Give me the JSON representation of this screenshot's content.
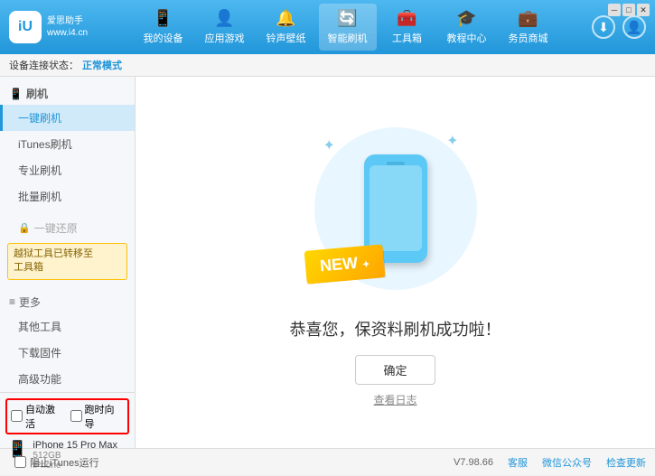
{
  "app": {
    "logo_icon": "iU",
    "logo_line1": "爱思助手",
    "logo_line2": "www.i4.cn"
  },
  "nav": {
    "items": [
      {
        "id": "my-device",
        "icon": "📱",
        "label": "我的设备"
      },
      {
        "id": "apps-games",
        "icon": "👤",
        "label": "应用游戏"
      },
      {
        "id": "ringtones",
        "icon": "🔔",
        "label": "铃声壁纸"
      },
      {
        "id": "smart-flash",
        "icon": "🔄",
        "label": "智能刷机",
        "active": true
      },
      {
        "id": "tools",
        "icon": "🧰",
        "label": "工具箱"
      },
      {
        "id": "tutorials",
        "icon": "🎓",
        "label": "教程中心"
      },
      {
        "id": "services",
        "icon": "💼",
        "label": "务员商城"
      }
    ],
    "download_icon": "⬇",
    "user_icon": "👤"
  },
  "status_bar": {
    "prefix": "设备连接状态：",
    "status": "正常模式"
  },
  "sidebar": {
    "flash_section": "刷机",
    "flash_items": [
      {
        "id": "one-key-flash",
        "label": "一键刷机",
        "active": true
      },
      {
        "id": "itunes-flash",
        "label": "iTunes刷机"
      },
      {
        "id": "pro-flash",
        "label": "专业刷机"
      },
      {
        "id": "batch-flash",
        "label": "批量刷机"
      }
    ],
    "one-key-restore_disabled": "一键还原",
    "warning_line1": "越狱工具已转移至",
    "warning_line2": "工具箱",
    "more_section": "更多",
    "more_items": [
      {
        "id": "other-tools",
        "label": "其他工具"
      },
      {
        "id": "download-firmware",
        "label": "下载固件"
      },
      {
        "id": "advanced",
        "label": "高级功能"
      }
    ],
    "auto_activate": "自动激活",
    "time_guide": "跑时向导",
    "device_name": "iPhone 15 Pro Max",
    "device_storage": "512GB",
    "device_type": "iPhone",
    "stop_itunes": "阻止iTunes运行"
  },
  "content": {
    "success_message": "恭喜您，保资料刷机成功啦！",
    "confirm_button": "确定",
    "log_link": "查看日志",
    "new_badge": "NEW"
  },
  "footer": {
    "version": "V7.98.66",
    "feedback": "客服",
    "wechat": "微信公众号",
    "check_update": "检查更新"
  }
}
